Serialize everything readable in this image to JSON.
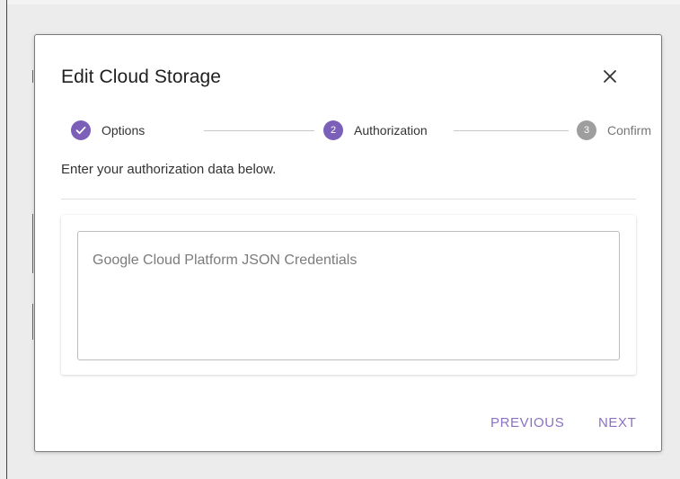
{
  "dialog": {
    "title": "Edit Cloud Storage",
    "close_icon": "close-icon",
    "subtitle": "Enter your authorization data below.",
    "steps": [
      {
        "label": "Options",
        "state": "completed",
        "icon": "check-icon"
      },
      {
        "label": "Authorization",
        "number": "2",
        "state": "active"
      },
      {
        "label": "Confirm",
        "number": "3",
        "state": "inactive"
      }
    ],
    "credentials_field": {
      "placeholder": "Google Cloud Platform JSON Credentials",
      "value": ""
    },
    "buttons": {
      "previous": "PREVIOUS",
      "next": "NEXT"
    }
  },
  "colors": {
    "accent": "#7b5fb8",
    "inactive_step": "#9e9e9e",
    "button_text": "#8a71c4"
  }
}
